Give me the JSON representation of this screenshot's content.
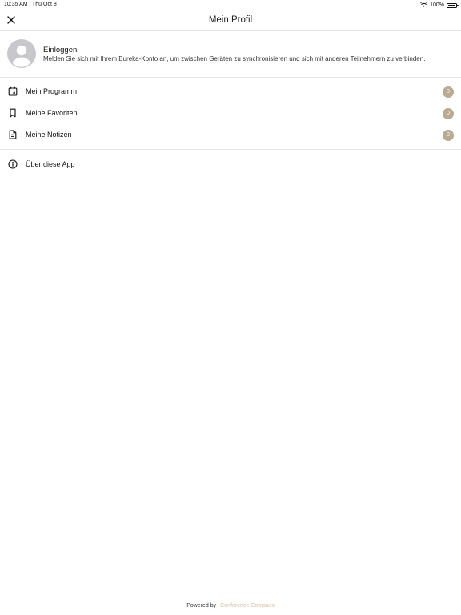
{
  "status_bar": {
    "time": "10:35 AM",
    "date": "Thu Oct 8",
    "battery_text": "100%",
    "battery_level": 1.0,
    "wifi_icon": "wifi-icon",
    "battery_icon": "battery-icon"
  },
  "nav": {
    "title": "Mein Profil",
    "close_icon": "close-icon"
  },
  "login": {
    "title": "Einloggen",
    "description": "Melden Sie sich mit Ihrem Eureka-Konto an, um zwischen Geräten zu synchronisieren und sich mit anderen Teilnehmern zu verbinden.",
    "avatar_icon": "avatar-placeholder-icon"
  },
  "menu": {
    "items": [
      {
        "label": "Mein Programm",
        "icon": "calendar-icon",
        "count": "0"
      },
      {
        "label": "Meine Favoriten",
        "icon": "bookmark-icon",
        "count": "0"
      },
      {
        "label": "Meine Notizen",
        "icon": "note-icon",
        "count": "0"
      }
    ],
    "about": {
      "label": "Über diese App",
      "icon": "info-icon"
    }
  },
  "footer": {
    "prefix": "Powered by",
    "link": "Conference Compass"
  },
  "colors": {
    "badge": "#b9ab92",
    "footer_link": "#d7bca0",
    "avatar_bg": "#c7c7cc",
    "divider": "#e8e8e8"
  }
}
